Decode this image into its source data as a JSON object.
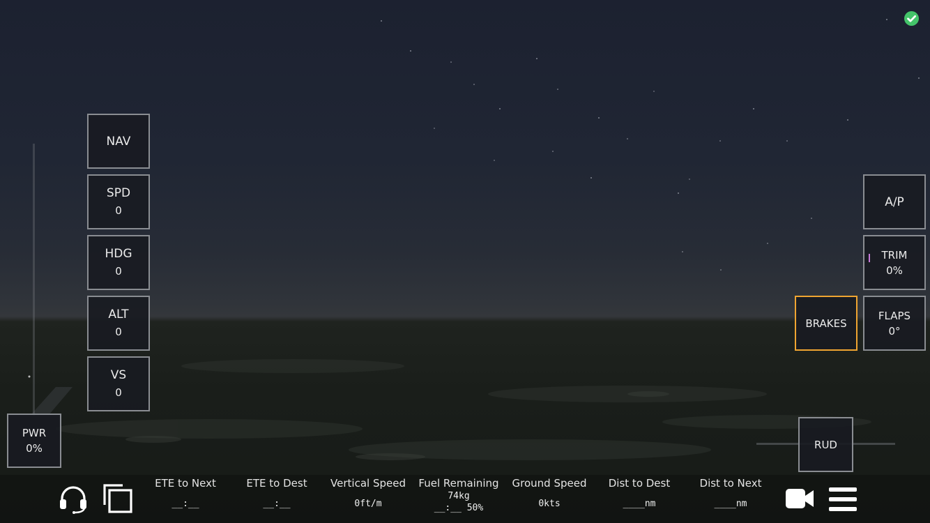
{
  "left_panel": [
    {
      "key": "nav",
      "label": "NAV",
      "value": ""
    },
    {
      "key": "spd",
      "label": "SPD",
      "value": "0"
    },
    {
      "key": "hdg",
      "label": "HDG",
      "value": "0"
    },
    {
      "key": "alt",
      "label": "ALT",
      "value": "0"
    },
    {
      "key": "vs",
      "label": "VS",
      "value": "0"
    }
  ],
  "power": {
    "label": "PWR",
    "value": "0%"
  },
  "right_panel": {
    "autopilot": {
      "label": "A/P"
    },
    "trim": {
      "label": "TRIM",
      "value": "0%"
    },
    "brakes": {
      "label": "BRAKES",
      "active": true
    },
    "flaps": {
      "label": "FLAPS",
      "value": "0°"
    },
    "rudder": {
      "label": "RUD"
    }
  },
  "status_bar": [
    {
      "label": "ETE to Next",
      "value": "__:__"
    },
    {
      "label": "ETE to Dest",
      "value": "__:__"
    },
    {
      "label": "Vertical Speed",
      "value": "0ft/m"
    },
    {
      "label": "Fuel Remaining",
      "value": "74kg",
      "value2": "__:__ 50%"
    },
    {
      "label": "Ground Speed",
      "value": "0kts"
    },
    {
      "label": "Dist to Dest",
      "value": "____nm"
    },
    {
      "label": "Dist to Next",
      "value": "____nm"
    }
  ],
  "icons": {
    "status": "check-circle-icon",
    "atc": "headset-icon",
    "copy": "copy-icon",
    "camera": "video-camera-icon",
    "menu": "hamburger-menu-icon"
  },
  "colors": {
    "active_border": "#f0a531",
    "status_ok": "#44c46a",
    "trim_indicator": "#c77ad8",
    "box_border": "#8a8d92"
  }
}
